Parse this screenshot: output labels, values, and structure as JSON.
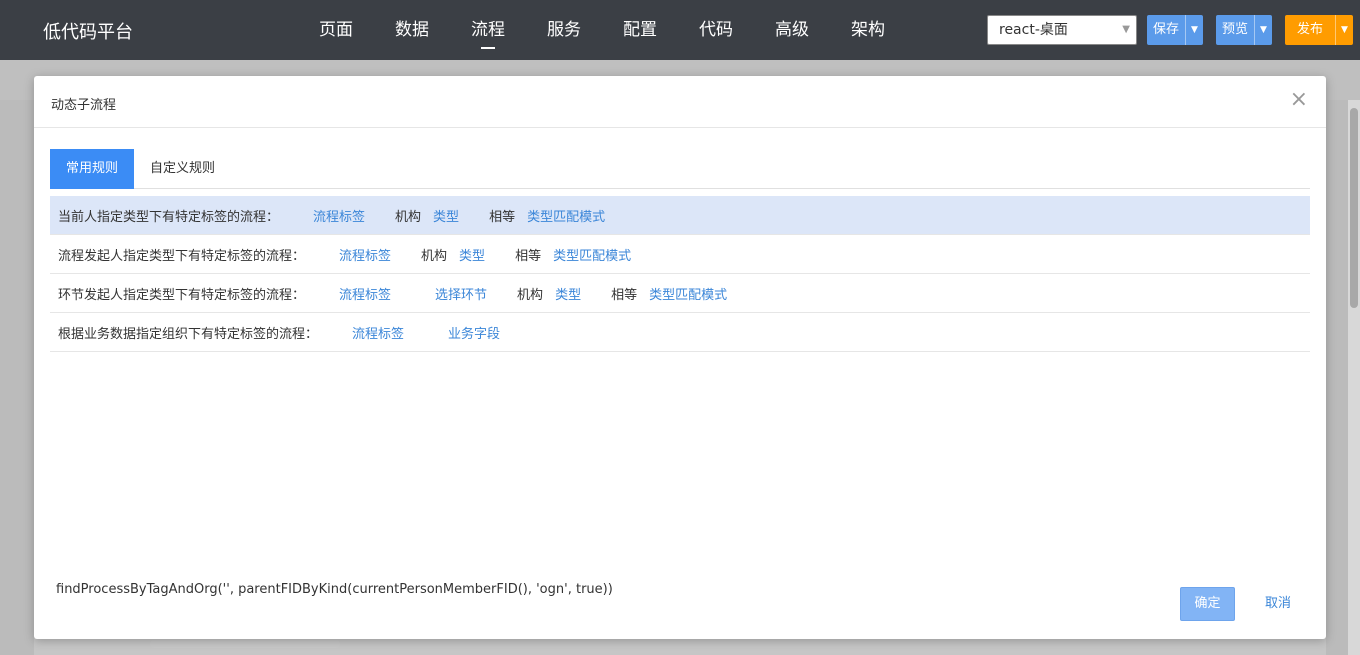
{
  "header": {
    "app_title": "低代码平台",
    "nav": [
      {
        "label": "页面",
        "active": false
      },
      {
        "label": "数据",
        "active": false
      },
      {
        "label": "流程",
        "active": true
      },
      {
        "label": "服务",
        "active": false
      },
      {
        "label": "配置",
        "active": false
      },
      {
        "label": "代码",
        "active": false
      },
      {
        "label": "高级",
        "active": false
      },
      {
        "label": "架构",
        "active": false
      }
    ],
    "target_select": "react-桌面",
    "save_label": "保存",
    "preview_label": "预览",
    "publish_label": "发布"
  },
  "dialog": {
    "title": "动态子流程",
    "close_icon": "close-icon",
    "tabs": [
      {
        "label": "常用规则",
        "active": true
      },
      {
        "label": "自定义规则",
        "active": false
      }
    ],
    "rules": [
      {
        "label": "当前人指定类型下有特定标签的流程：",
        "selected": true,
        "parts": [
          "流程标签",
          "机构",
          "类型",
          "相等",
          "类型匹配模式"
        ]
      },
      {
        "label": "流程发起人指定类型下有特定标签的流程：",
        "selected": false,
        "parts": [
          "流程标签",
          "机构",
          "类型",
          "相等",
          "类型匹配模式"
        ]
      },
      {
        "label": "环节发起人指定类型下有特定标签的流程：",
        "selected": false,
        "parts": [
          "流程标签",
          "选择环节",
          "机构",
          "类型",
          "相等",
          "类型匹配模式"
        ]
      },
      {
        "label": "根据业务数据指定组织下有特定标签的流程：",
        "selected": false,
        "parts": [
          "流程标签",
          "业务字段"
        ]
      }
    ],
    "expression": "findProcessByTagAndOrg('', parentFIDByKind(currentPersonMemberFID(), 'ogn', true))",
    "confirm_label": "确定",
    "cancel_label": "取消"
  },
  "colors": {
    "topbar": "#3b3f45",
    "accent": "#3b8cf5",
    "link": "#3b86d8",
    "publish": "#ff9c00"
  }
}
